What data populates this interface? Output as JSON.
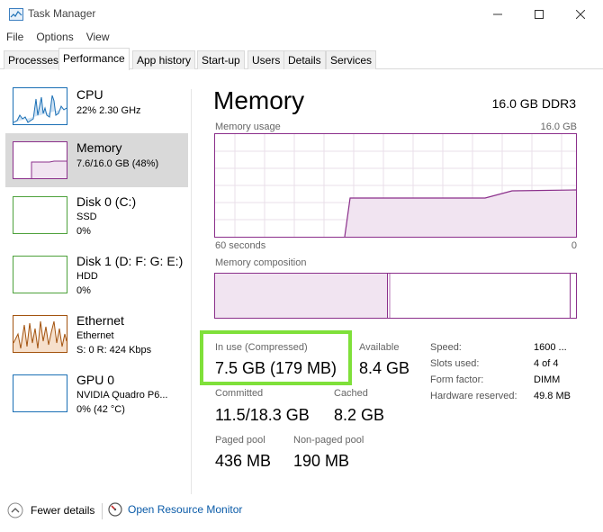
{
  "window": {
    "title": "Task Manager"
  },
  "menu": [
    "File",
    "Options",
    "View"
  ],
  "tabs": [
    "Processes",
    "Performance",
    "App history",
    "Start-up",
    "Users",
    "Details",
    "Services"
  ],
  "sidebar": [
    {
      "name": "CPU",
      "line1": "22%  2.30 GHz",
      "line2": ""
    },
    {
      "name": "Memory",
      "line1": "7.6/16.0 GB (48%)",
      "line2": ""
    },
    {
      "name": "Disk 0 (C:)",
      "line1": "SSD",
      "line2": "0%"
    },
    {
      "name": "Disk 1 (D: F: G: E:)",
      "line1": "HDD",
      "line2": "0%"
    },
    {
      "name": "Ethernet",
      "line1": "Ethernet",
      "line2": "S: 0  R: 424 Kbps"
    },
    {
      "name": "GPU 0",
      "line1": "NVIDIA Quadro P6...",
      "line2": "0% (42 °C)"
    }
  ],
  "main": {
    "title": "Memory",
    "spec": "16.0 GB DDR3",
    "usage_label": "Memory usage",
    "usage_max": "16.0 GB",
    "time_left": "60 seconds",
    "time_right": "0",
    "composition_label": "Memory composition",
    "in_use_label": "In use (Compressed)",
    "in_use_value": "7.5 GB (179 MB)",
    "available_label": "Available",
    "available_value": "8.4 GB",
    "committed_label": "Committed",
    "committed_value": "11.5/18.3 GB",
    "cached_label": "Cached",
    "cached_value": "8.2 GB",
    "paged_label": "Paged pool",
    "paged_value": "436 MB",
    "nonpaged_label": "Non-paged pool",
    "nonpaged_value": "190 MB",
    "stats": [
      {
        "label": "Speed:",
        "value": "1600 ..."
      },
      {
        "label": "Slots used:",
        "value": "4 of 4"
      },
      {
        "label": "Form factor:",
        "value": "DIMM"
      },
      {
        "label": "Hardware reserved:",
        "value": "49.8 MB"
      }
    ]
  },
  "footer": {
    "fewer_details": "Fewer details",
    "resource_monitor": "Open Resource Monitor"
  },
  "colors": {
    "memory": "#8b2f8b",
    "cpu": "#1a6fb5",
    "disk": "#4da13b",
    "ethernet": "#a3530f",
    "highlight": "#7fe03a",
    "link": "#0a5ba8"
  }
}
